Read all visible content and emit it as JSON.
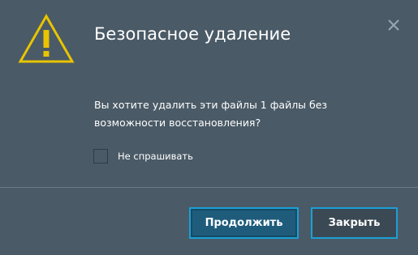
{
  "dialog": {
    "title": "Безопасное удаление",
    "message": "Вы хотите удалить эти файлы 1 файлы без возможности восстановления?",
    "checkbox": {
      "label": "Не спрашивать",
      "checked": false
    },
    "buttons": {
      "continue_label": "Продолжить",
      "close_label": "Закрыть"
    }
  },
  "icons": {
    "warning": "warning-triangle-icon",
    "close": "close-icon"
  },
  "colors": {
    "background": "#4a5a66",
    "accent": "#1aa0d8",
    "warning": "#e8c400",
    "primary_button": "#1f5c7c"
  }
}
